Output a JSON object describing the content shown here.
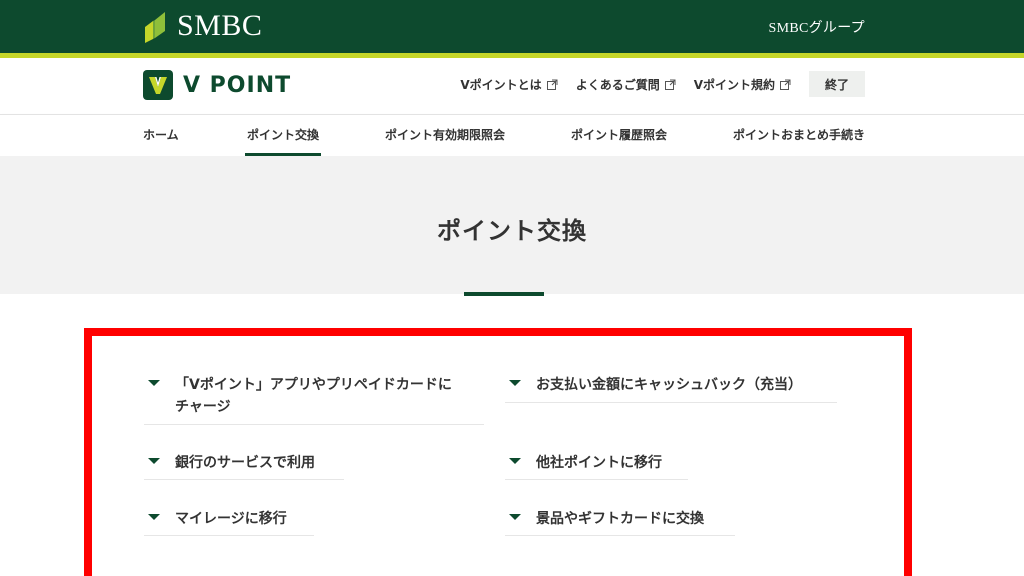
{
  "topbar": {
    "brand": "SMBC",
    "group_link": "SMBCグループ",
    "accent_color": "#c5d62a",
    "bg_color": "#0d4a2e"
  },
  "header": {
    "logo_text": "V POINT",
    "logo_badge": "V",
    "links": [
      {
        "label": "Vポイントとは",
        "icon": "external-link-icon"
      },
      {
        "label": "よくあるご質問",
        "icon": "external-link-icon"
      },
      {
        "label": "Vポイント規約",
        "icon": "external-link-icon"
      }
    ],
    "end_button": "終了"
  },
  "nav": {
    "items": [
      {
        "label": "ホーム",
        "active": false
      },
      {
        "label": "ポイント交換",
        "active": true
      },
      {
        "label": "ポイント有効期限照会",
        "active": false
      },
      {
        "label": "ポイント履歴照会",
        "active": false
      },
      {
        "label": "ポイントおまとめ手続き",
        "active": false
      }
    ]
  },
  "main": {
    "title": "ポイント交換",
    "links": [
      {
        "label_line1": "「Vポイント」アプリやプリペイドカードに",
        "label_line2": "チャージ"
      },
      {
        "label": "お支払い金額にキャッシュバック（充当）"
      },
      {
        "label": "銀行のサービスで利用"
      },
      {
        "label": "他社ポイントに移行"
      },
      {
        "label": "マイレージに移行"
      },
      {
        "label": "景品やギフトカードに交換"
      }
    ]
  }
}
